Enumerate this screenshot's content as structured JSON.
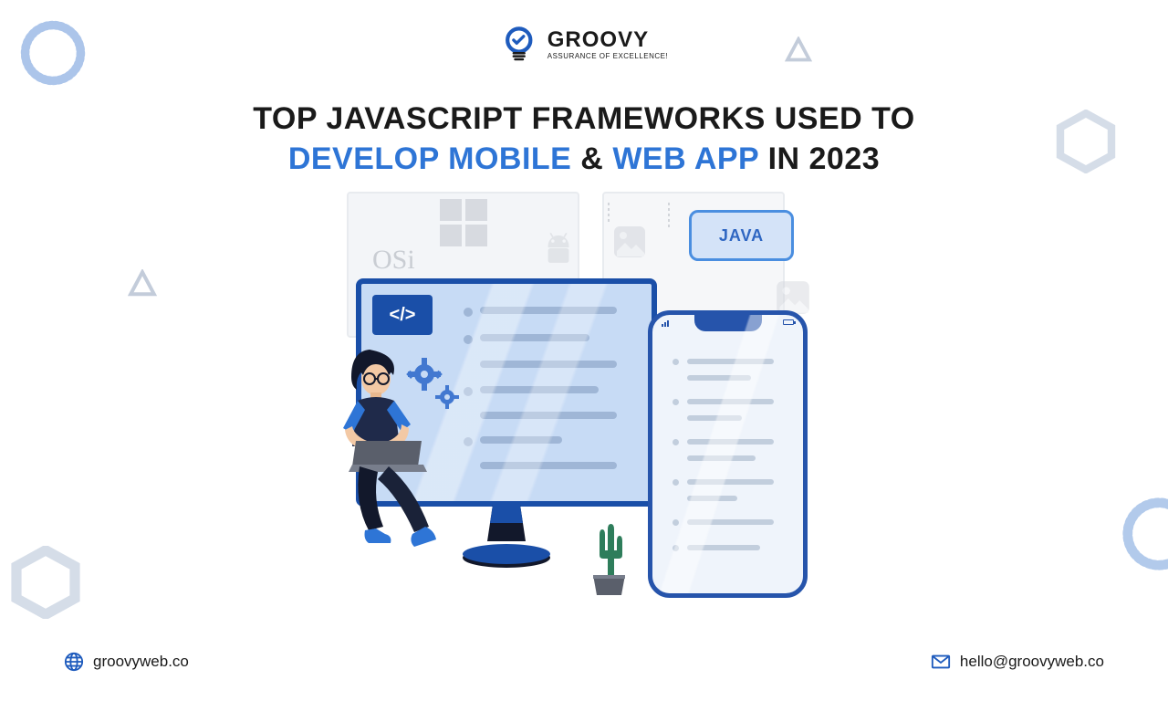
{
  "logo": {
    "brand": "GROOVY",
    "tagline": "ASSURANCE OF EXCELLENCE!"
  },
  "title": {
    "line1_a": "TOP JAVASCRIPT FRAMEWORKS USED TO",
    "line2_hl1": "DEVELOP MOBILE",
    "line2_amp": " & ",
    "line2_hl2": "WEB APP",
    "line2_b": " IN 2023"
  },
  "illus": {
    "osi": "OSi",
    "java": "JAVA",
    "code_symbol": "</>"
  },
  "footer": {
    "website": "groovyweb.co",
    "email": "hello@groovyweb.co"
  },
  "colors": {
    "accent": "#2e75d6",
    "dark_blue": "#1a4fa8",
    "text": "#1a1a1a"
  }
}
